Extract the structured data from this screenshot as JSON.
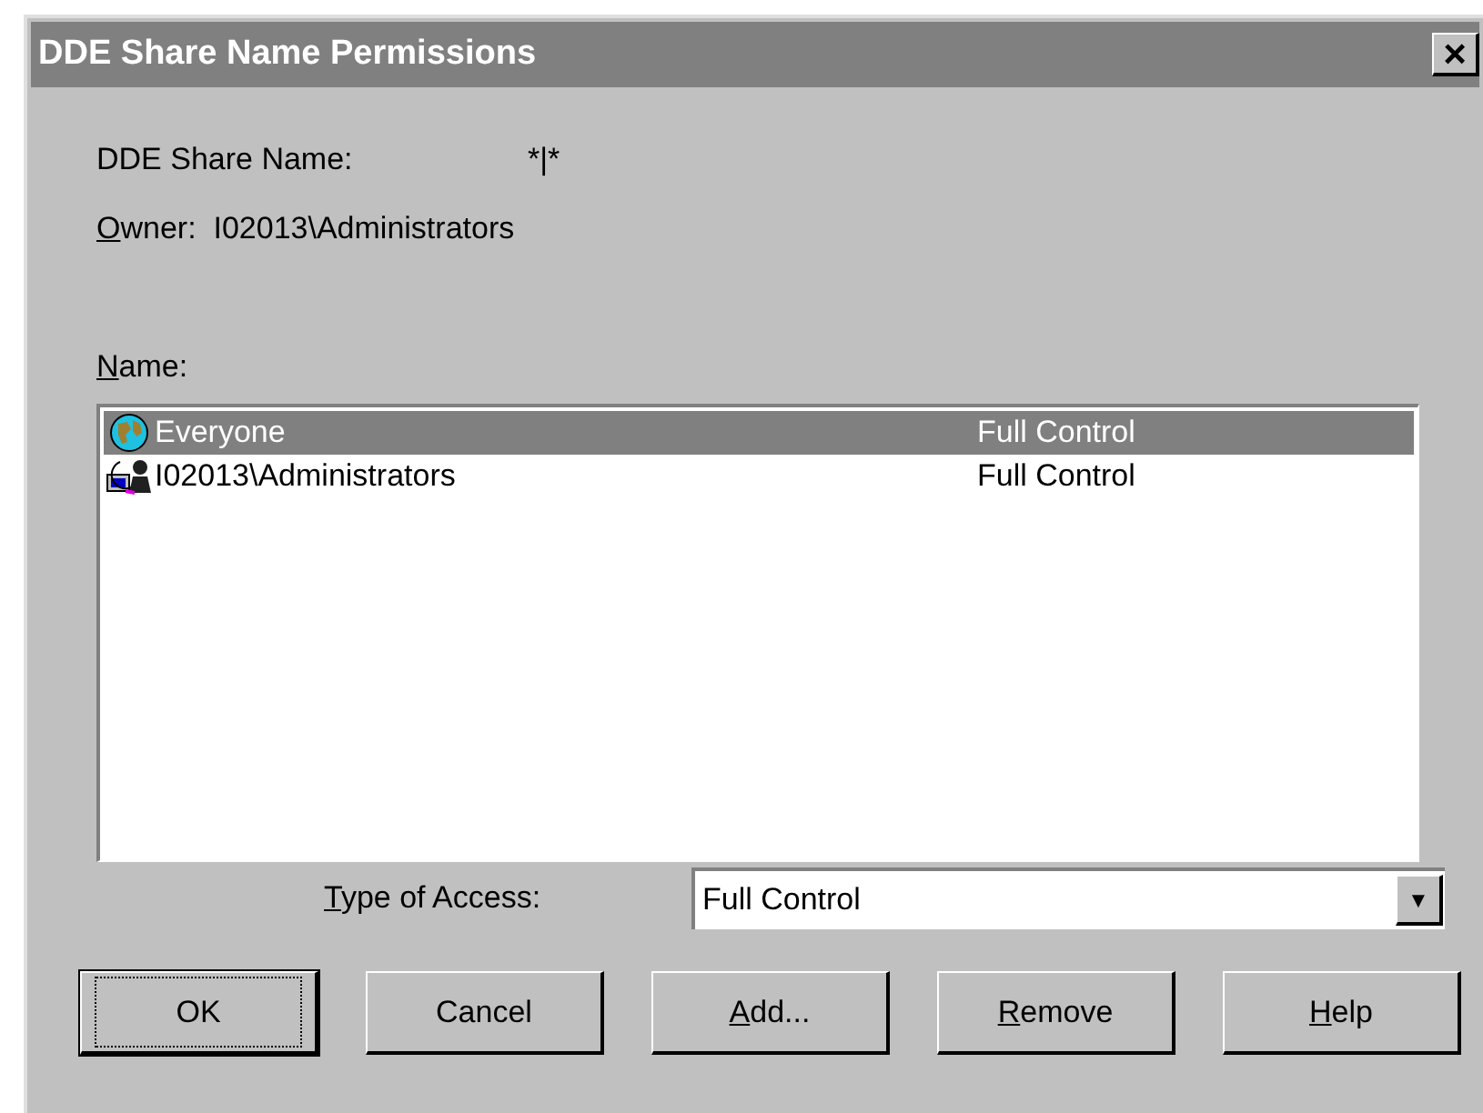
{
  "window": {
    "title": "DDE Share Name Permissions",
    "close": "×"
  },
  "share_name": {
    "label": "DDE Share Name:",
    "value": "*|*"
  },
  "owner": {
    "mnemonic": "O",
    "rest": "wner:  I02013\\Administrators"
  },
  "name_label": {
    "mnemonic": "N",
    "rest": "ame:"
  },
  "names": [
    {
      "kind": "globe",
      "name": "Everyone",
      "access": "Full Control",
      "selected": true
    },
    {
      "kind": "group",
      "name": "I02013\\Administrators",
      "access": "Full Control",
      "selected": false
    }
  ],
  "type_of_access": {
    "mnemonic": "T",
    "rest": "ype of Access:",
    "value": "Full Control",
    "arrow": "▼"
  },
  "buttons": [
    {
      "rest": "OK",
      "default": true
    },
    {
      "rest": "Cancel",
      "default": false
    },
    {
      "mnemonic": "A",
      "rest": "dd...",
      "default": false
    },
    {
      "mnemonic": "R",
      "rest": "emove",
      "default": false
    },
    {
      "mnemonic": "H",
      "rest": "elp",
      "default": false
    }
  ]
}
